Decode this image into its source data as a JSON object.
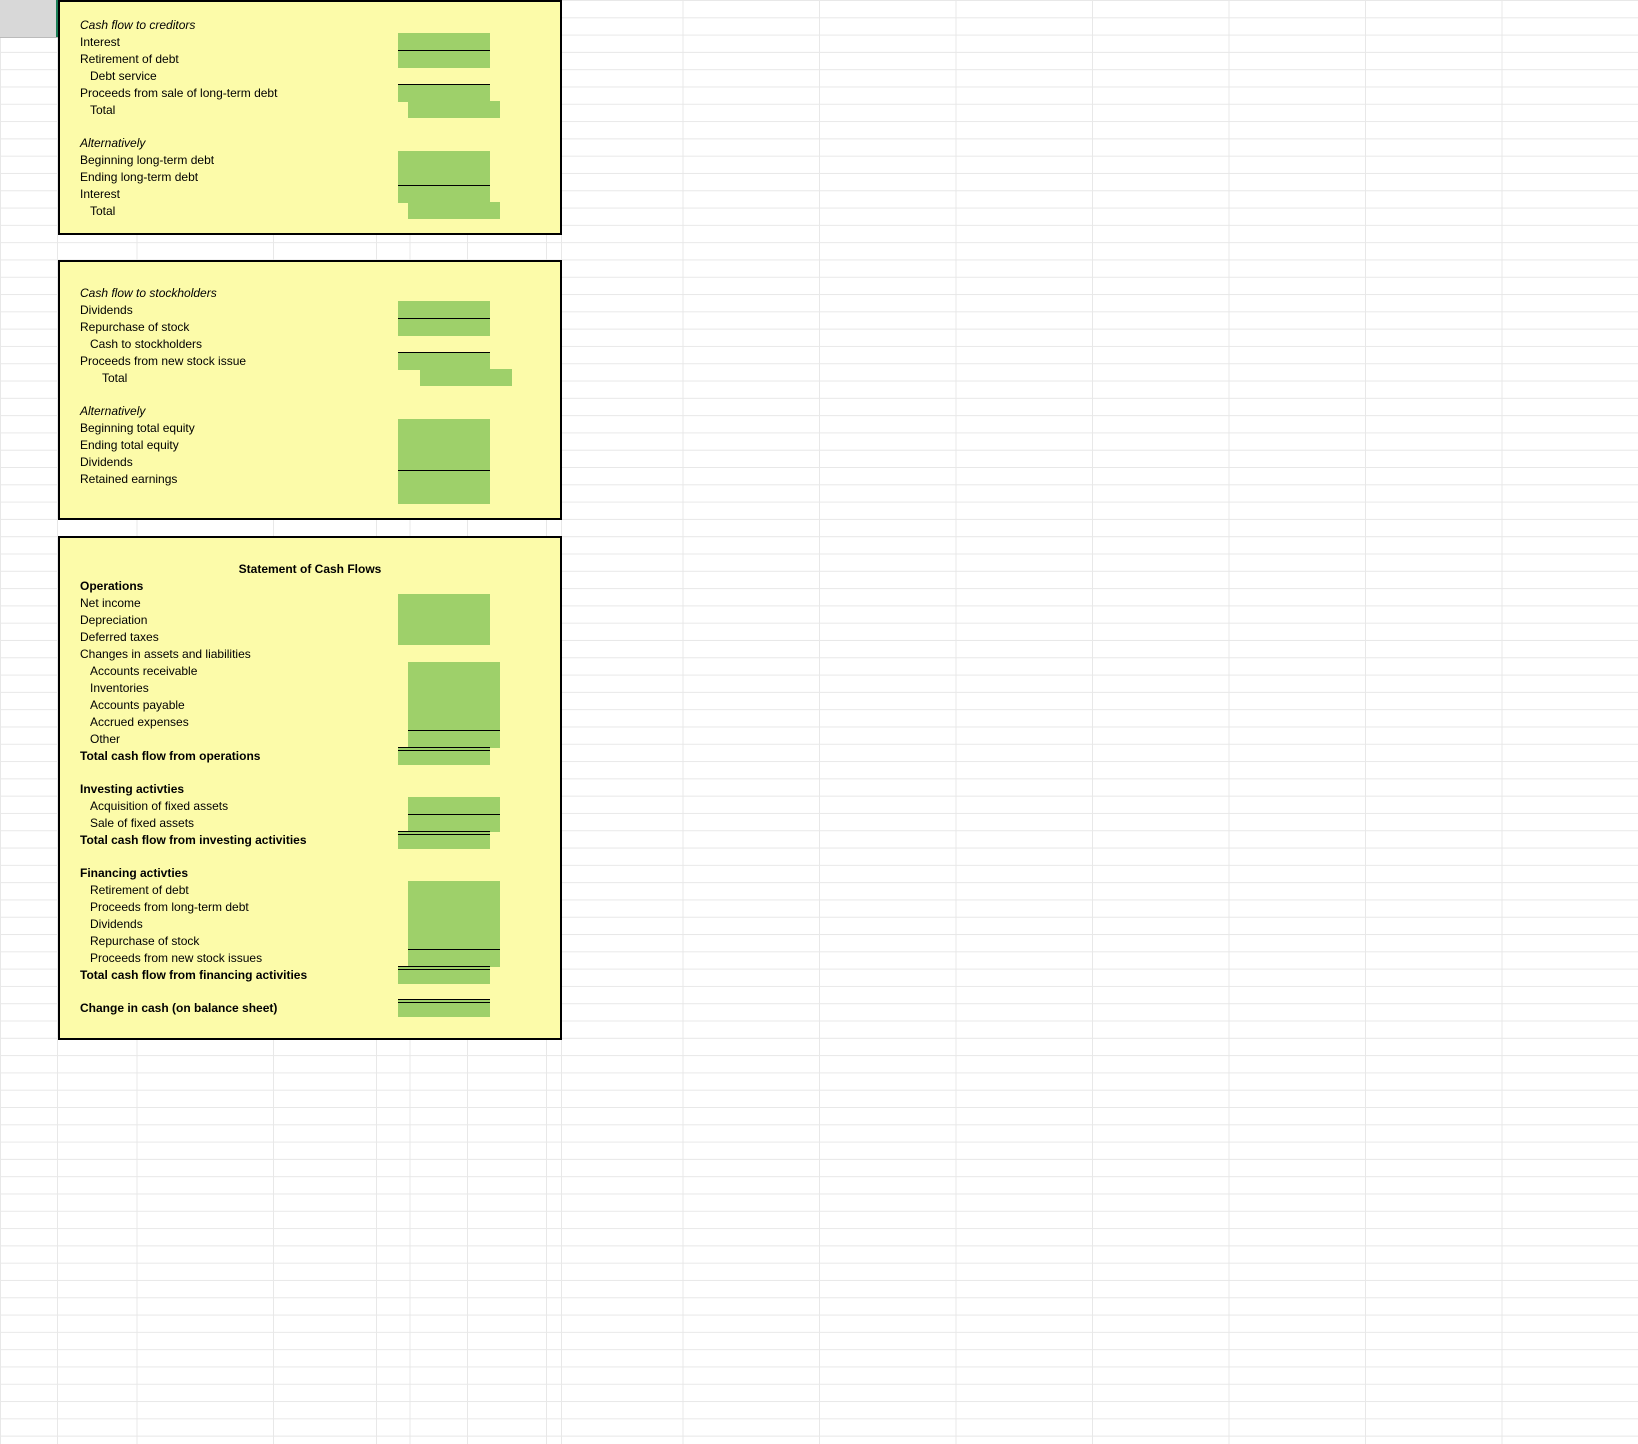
{
  "section1": {
    "title": "Cash flow to creditors",
    "rows": [
      {
        "label": "Interest",
        "green": true
      },
      {
        "label": "Retirement of debt",
        "green": true,
        "border": "bt"
      },
      {
        "label": "Debt service",
        "indent": 1
      },
      {
        "label": "Proceeds from sale of long-term debt",
        "green": true,
        "border": "bt"
      },
      {
        "label": "Total",
        "indent": 1,
        "green": true
      }
    ],
    "alt_title": "Alternatively",
    "alt_rows": [
      {
        "label": "Beginning long-term debt",
        "green": true
      },
      {
        "label": "Ending long-term debt",
        "green": true
      },
      {
        "label": "Interest",
        "green": true,
        "border": "bt"
      },
      {
        "label": "Total",
        "indent": 1,
        "green": true
      }
    ]
  },
  "section2": {
    "title": "Cash flow to stockholders",
    "rows": [
      {
        "label": "Dividends",
        "green": true
      },
      {
        "label": "Repurchase of stock",
        "green": true,
        "border": "bt"
      },
      {
        "label": "Cash to stockholders",
        "indent": 1
      },
      {
        "label": "Proceeds from new stock issue",
        "green": true,
        "border": "bt"
      },
      {
        "label": "Total",
        "indent": 2,
        "green": true
      }
    ],
    "alt_title": "Alternatively",
    "alt_rows": [
      {
        "label": "Beginning total equity",
        "green": true
      },
      {
        "label": "Ending total equity",
        "green": true
      },
      {
        "label": "Dividends",
        "green": true
      },
      {
        "label": "Retained earnings",
        "green": true,
        "border": "bt"
      },
      {
        "label": "",
        "green": true
      }
    ]
  },
  "section3": {
    "title": "Statement of Cash Flows",
    "ops_title": "Operations",
    "ops_rows": [
      {
        "label": "Net income",
        "green": true
      },
      {
        "label": "Depreciation",
        "green": true
      },
      {
        "label": "Deferred taxes",
        "green": true
      },
      {
        "label": "Changes in assets and liabilities"
      },
      {
        "label": "Accounts receivable",
        "indent": 1,
        "green": true
      },
      {
        "label": "Inventories",
        "indent": 1,
        "green": true
      },
      {
        "label": "Accounts payable",
        "indent": 1,
        "green": true
      },
      {
        "label": "Accrued expenses",
        "indent": 1,
        "green": true
      },
      {
        "label": "Other",
        "indent": 1,
        "green": true,
        "border": "bt"
      },
      {
        "label": "Total cash flow from operations",
        "bold": true,
        "green": true,
        "border": "bdt"
      }
    ],
    "inv_title": "Investing activties",
    "inv_rows": [
      {
        "label": "Acquisition of fixed assets",
        "indent": 1,
        "green": true
      },
      {
        "label": "Sale of fixed assets",
        "indent": 1,
        "green": true,
        "border": "bt"
      },
      {
        "label": "Total cash flow from investing activities",
        "bold": true,
        "green": true,
        "border": "bdt"
      }
    ],
    "fin_title": "Financing activties",
    "fin_rows": [
      {
        "label": "Retirement of debt",
        "indent": 1,
        "green": true
      },
      {
        "label": "Proceeds from long-term debt",
        "indent": 1,
        "green": true
      },
      {
        "label": "Dividends",
        "indent": 1,
        "green": true
      },
      {
        "label": "Repurchase of stock",
        "indent": 1,
        "green": true
      },
      {
        "label": "Proceeds from new stock issues",
        "indent": 1,
        "green": true,
        "border": "bt"
      },
      {
        "label": "Total cash flow from financing activities",
        "bold": true,
        "green": true,
        "border": "bdt"
      }
    ],
    "change_label": "Change in cash (on balance sheet)"
  }
}
